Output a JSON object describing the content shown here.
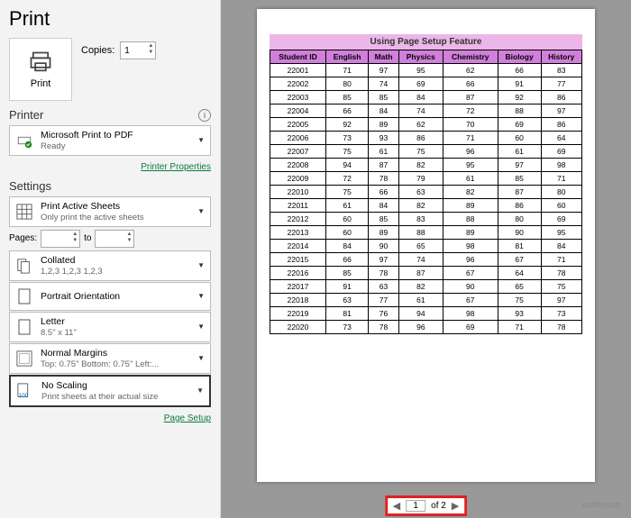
{
  "header": {
    "title": "Print"
  },
  "printBtn": {
    "label": "Print"
  },
  "copies": {
    "label": "Copies:",
    "value": "1"
  },
  "printer": {
    "heading": "Printer",
    "name": "Microsoft Print to PDF",
    "status": "Ready",
    "propsLink": "Printer Properties"
  },
  "settings": {
    "heading": "Settings",
    "activeSheets": {
      "t1": "Print Active Sheets",
      "t2": "Only print the active sheets"
    },
    "pagesLabel": "Pages:",
    "toLabel": "to",
    "collated": {
      "t1": "Collated",
      "t2": "1,2,3   1,2,3   1,2,3"
    },
    "orientation": {
      "t1": "Portrait Orientation"
    },
    "paper": {
      "t1": "Letter",
      "t2": "8.5\" x 11\""
    },
    "margins": {
      "t1": "Normal Margins",
      "t2": "Top: 0.75\" Bottom: 0.75\" Left:..."
    },
    "scaling": {
      "t1": "No Scaling",
      "t2": "Print sheets at their actual size"
    },
    "pageSetup": "Page Setup"
  },
  "preview": {
    "tableTitle": "Using Page Setup Feature",
    "headers": [
      "Student ID",
      "English",
      "Math",
      "Physics",
      "Chemistry",
      "Biology",
      "History"
    ],
    "rows": [
      [
        "22001",
        "71",
        "97",
        "95",
        "62",
        "66",
        "83"
      ],
      [
        "22002",
        "80",
        "74",
        "69",
        "66",
        "91",
        "77"
      ],
      [
        "22003",
        "85",
        "85",
        "84",
        "87",
        "92",
        "86"
      ],
      [
        "22004",
        "66",
        "84",
        "74",
        "72",
        "88",
        "97"
      ],
      [
        "22005",
        "92",
        "89",
        "62",
        "70",
        "69",
        "86"
      ],
      [
        "22006",
        "73",
        "93",
        "86",
        "71",
        "60",
        "64"
      ],
      [
        "22007",
        "75",
        "61",
        "75",
        "96",
        "61",
        "69"
      ],
      [
        "22008",
        "94",
        "87",
        "82",
        "95",
        "97",
        "98"
      ],
      [
        "22009",
        "72",
        "78",
        "79",
        "61",
        "85",
        "71"
      ],
      [
        "22010",
        "75",
        "66",
        "63",
        "82",
        "87",
        "80"
      ],
      [
        "22011",
        "61",
        "84",
        "82",
        "89",
        "86",
        "60"
      ],
      [
        "22012",
        "60",
        "85",
        "83",
        "88",
        "80",
        "69"
      ],
      [
        "22013",
        "60",
        "89",
        "88",
        "89",
        "90",
        "95"
      ],
      [
        "22014",
        "84",
        "90",
        "65",
        "98",
        "81",
        "84"
      ],
      [
        "22015",
        "66",
        "97",
        "74",
        "96",
        "67",
        "71"
      ],
      [
        "22016",
        "85",
        "78",
        "87",
        "67",
        "64",
        "78"
      ],
      [
        "22017",
        "91",
        "63",
        "82",
        "90",
        "65",
        "75"
      ],
      [
        "22018",
        "63",
        "77",
        "61",
        "67",
        "75",
        "97"
      ],
      [
        "22019",
        "81",
        "76",
        "94",
        "98",
        "93",
        "73"
      ],
      [
        "22020",
        "73",
        "78",
        "96",
        "69",
        "71",
        "78"
      ]
    ]
  },
  "pager": {
    "current": "1",
    "total": "of 2"
  },
  "watermark": "wsxdn.com"
}
